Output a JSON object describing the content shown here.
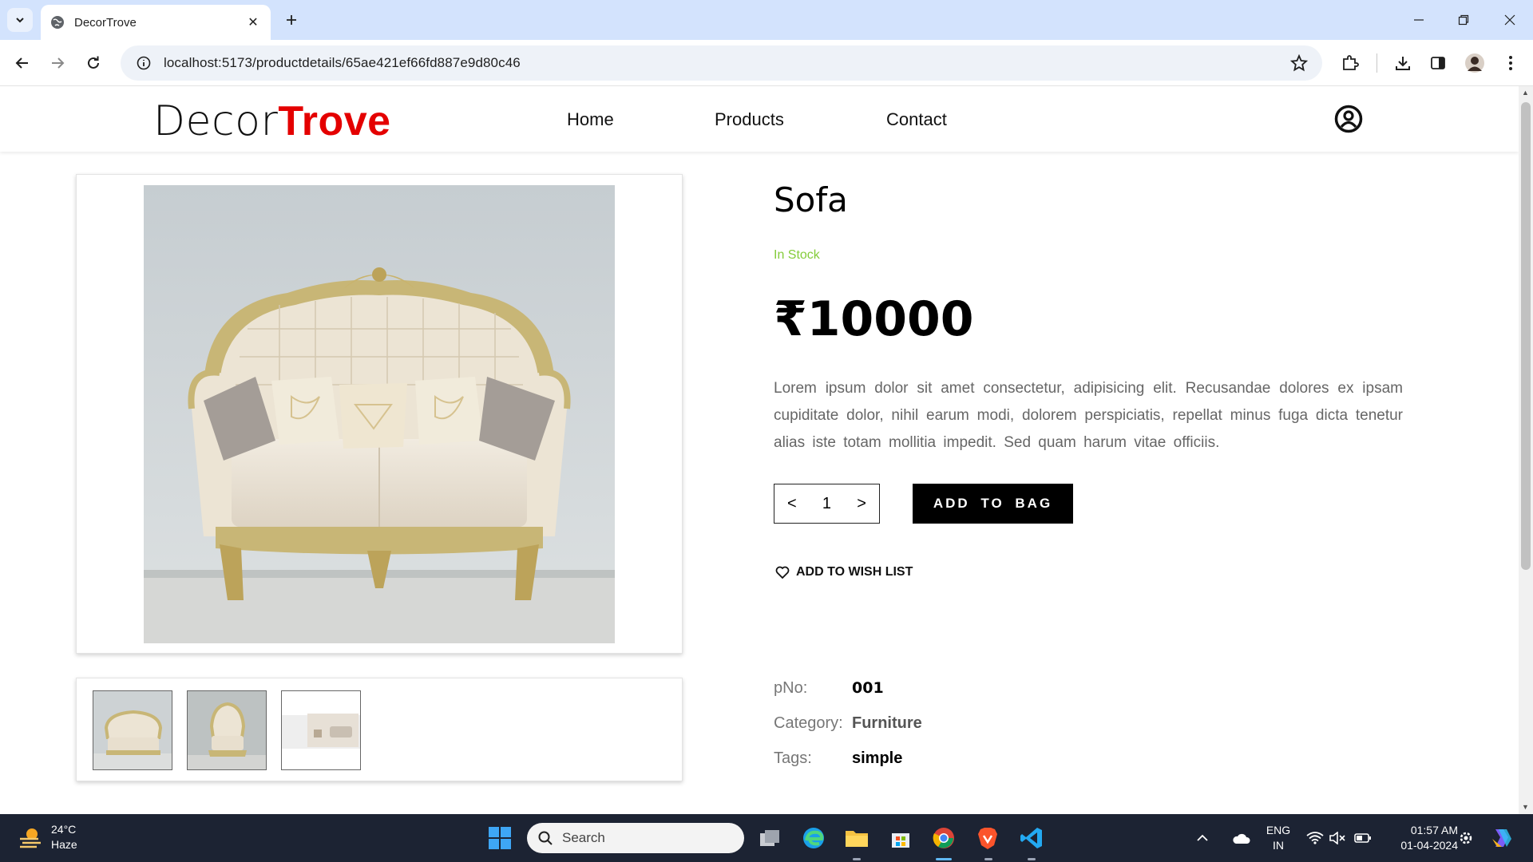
{
  "browser": {
    "tab_title": "DecorTrove",
    "url": "localhost:5173/productdetails/65ae421ef66fd887e9d80c46"
  },
  "site": {
    "logo_part1": "Decor",
    "logo_part2": "Trove",
    "nav": [
      "Home",
      "Products",
      "Contact"
    ],
    "logo_accent_color": "#e40000"
  },
  "product": {
    "title": "Sofa",
    "stock_status": "In Stock",
    "price": "₹10000",
    "description": "Lorem ipsum dolor sit amet consectetur, adipisicing elit. Recusandae dolores ex ipsam cupiditate dolor, nihil earum modi, dolorem perspiciatis, repellat minus fuga dicta tenetur alias iste totam mollitia impedit. Sed quam harum vitae officiis.",
    "quantity": "1",
    "qty_decrease": "<",
    "qty_increase": ">",
    "add_to_bag": "ADD TO BAG",
    "add_to_wishlist": "ADD TO WISH LIST",
    "meta": {
      "pno_label": "pNo:",
      "pno_value": "001",
      "category_label": "Category:",
      "category_value": "Furniture",
      "tags_label": "Tags:",
      "tags_value": "simple"
    },
    "stock_color": "#84cc3a"
  },
  "taskbar": {
    "weather_temp": "24°C",
    "weather_desc": "Haze",
    "search_placeholder": "Search",
    "lang_line1": "ENG",
    "lang_line2": "IN",
    "time": "01:57 AM",
    "date": "01-04-2024"
  }
}
